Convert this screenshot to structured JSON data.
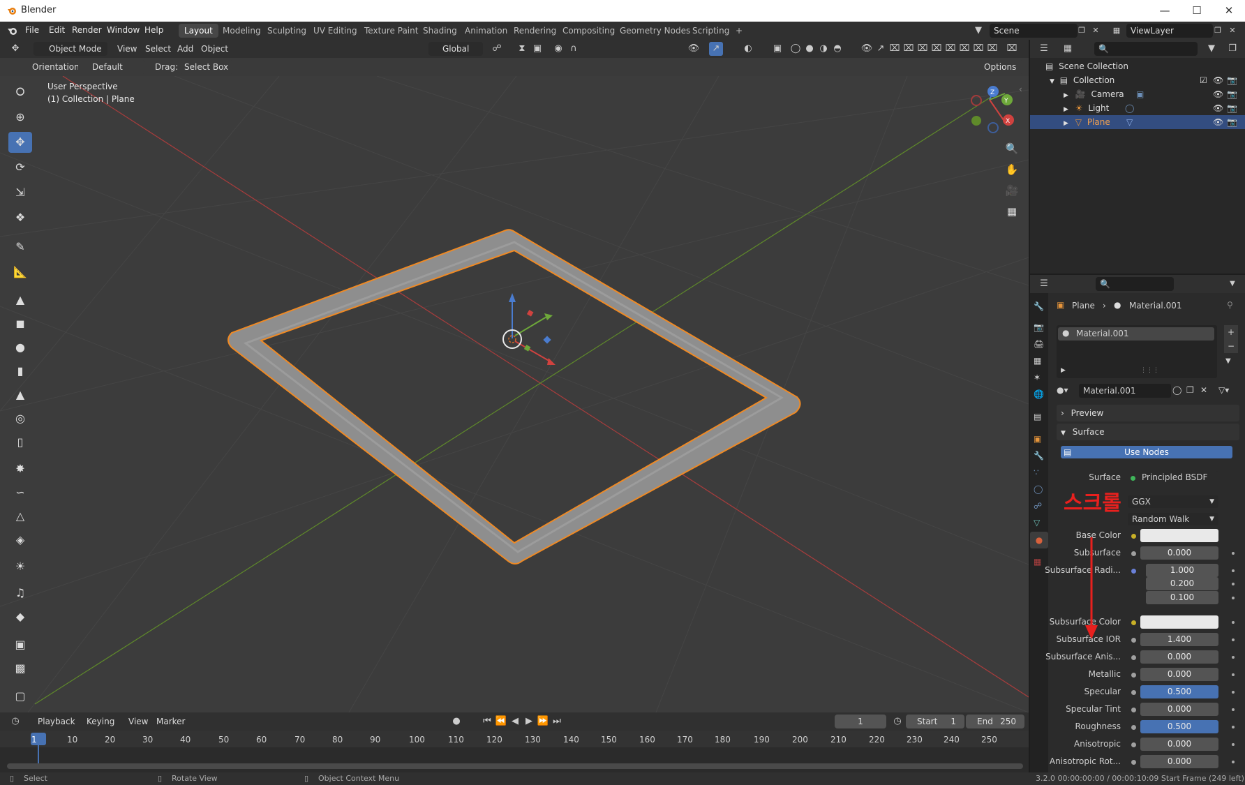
{
  "window": {
    "title": "Blender"
  },
  "menu": [
    "File",
    "Edit",
    "Render",
    "Window",
    "Help"
  ],
  "workspaces": [
    "Layout",
    "Modeling",
    "Sculpting",
    "UV Editing",
    "Texture Paint",
    "Shading",
    "Animation",
    "Rendering",
    "Compositing",
    "Geometry Nodes",
    "Scripting",
    "+"
  ],
  "active_workspace": "Layout",
  "scene": "Scene",
  "view_layer": "ViewLayer",
  "viewport_header": {
    "mode": "Object Mode",
    "view": "View",
    "select": "Select",
    "add": "Add",
    "object": "Object",
    "transform_orientation": "Global",
    "orientation_label": "Orientation:",
    "orientation_value": "Default",
    "drag_label": "Drag:",
    "drag_value": "Select Box",
    "options": "Options"
  },
  "viewport": {
    "perspective": "User Perspective",
    "collection_info": "(1) Collection | Plane",
    "gizmo_axes": [
      "X",
      "Y",
      "Z"
    ]
  },
  "outliner": {
    "scene_collection": "Scene Collection",
    "collection": "Collection",
    "items": [
      "Camera",
      "Light",
      "Plane"
    ],
    "selected": "Plane"
  },
  "properties": {
    "breadcrumb_object": "Plane",
    "breadcrumb_material": "Material.001",
    "material_slot": "Material.001",
    "material_name": "Material.001",
    "sections": {
      "preview": "Preview",
      "surface": "Surface"
    },
    "use_nodes": "Use Nodes",
    "surface_label": "Surface",
    "surface_shader": "Principled BSDF",
    "distribution": "GGX",
    "subsurface_method": "Random Walk",
    "rows": [
      {
        "label": "Base Color",
        "value": "",
        "kind": "color",
        "dot": "#c8b027"
      },
      {
        "label": "Subsurface",
        "value": "0.000",
        "kind": "num",
        "dot": "#a0a0a0"
      },
      {
        "label": "Subsurface Radi...",
        "value": "1.000",
        "kind": "num",
        "dot": "#6a80d8"
      },
      {
        "label": "",
        "value": "0.200",
        "kind": "num",
        "dot": ""
      },
      {
        "label": "",
        "value": "0.100",
        "kind": "num",
        "dot": ""
      },
      {
        "label": "Subsurface Color",
        "value": "",
        "kind": "color",
        "dot": "#c8b027"
      },
      {
        "label": "Subsurface IOR",
        "value": "1.400",
        "kind": "num",
        "dot": "#a0a0a0"
      },
      {
        "label": "Subsurface Anis...",
        "value": "0.000",
        "kind": "num",
        "dot": "#a0a0a0"
      },
      {
        "label": "Metallic",
        "value": "0.000",
        "kind": "num",
        "dot": "#a0a0a0"
      },
      {
        "label": "Specular",
        "value": "0.500",
        "kind": "blue",
        "dot": "#a0a0a0"
      },
      {
        "label": "Specular Tint",
        "value": "0.000",
        "kind": "num",
        "dot": "#a0a0a0"
      },
      {
        "label": "Roughness",
        "value": "0.500",
        "kind": "blue",
        "dot": "#a0a0a0"
      },
      {
        "label": "Anisotropic",
        "value": "0.000",
        "kind": "num",
        "dot": "#a0a0a0"
      },
      {
        "label": "Anisotropic Rot...",
        "value": "0.000",
        "kind": "num",
        "dot": "#a0a0a0"
      }
    ],
    "annotation_text": "스크롤"
  },
  "timeline": {
    "playback": "Playback",
    "keying": "Keying",
    "view": "View",
    "marker": "Marker",
    "current_frame": "1",
    "start_label": "Start",
    "start": "1",
    "end_label": "End",
    "end": "250",
    "ruler": [
      "1",
      "10",
      "20",
      "30",
      "40",
      "50",
      "60",
      "70",
      "80",
      "90",
      "100",
      "110",
      "120",
      "130",
      "140",
      "150",
      "160",
      "170",
      "180",
      "190",
      "200",
      "210",
      "220",
      "230",
      "240",
      "250"
    ]
  },
  "status": {
    "select": "Select",
    "rotate": "Rotate View",
    "context": "Object Context Menu",
    "info": "3.2.0  00:00:00:00 / 00:00:10:09  Start Frame (249 left)"
  },
  "colors": {
    "accent": "#4772b3",
    "selection_outline": "#f08a24",
    "annotation": "#e8201e"
  }
}
